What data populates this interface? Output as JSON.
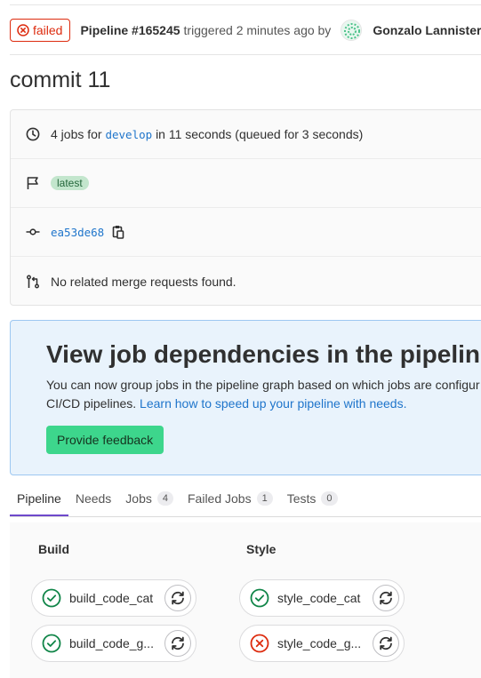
{
  "header": {
    "status_label": "failed",
    "pipeline_id": "Pipeline #165245",
    "triggered_text": "triggered 2 minutes ago by",
    "user_name": "Gonzalo Lannister"
  },
  "commit_title": "commit 11",
  "info": {
    "jobs_prefix": "4 jobs for",
    "branch": "develop",
    "jobs_suffix": "in 11 seconds (queued for 3 seconds)",
    "badge": "latest",
    "commit_sha": "ea53de68",
    "merge_requests": "No related merge requests found."
  },
  "banner": {
    "title": "View job dependencies in the pipeline",
    "text": "You can now group jobs in the pipeline graph based on which jobs are configured to run first, if you use the needs: keyword to establish job dependencies in your CI/CD pipelines.",
    "text_visible_1": "You can now group jobs in the pipeline graph based on which jobs are configur",
    "text_visible_2": "CI/CD pipelines.",
    "link": "Learn how to speed up your pipeline with needs.",
    "button": "Provide feedback"
  },
  "tabs": [
    {
      "label": "Pipeline",
      "count": null
    },
    {
      "label": "Needs",
      "count": null
    },
    {
      "label": "Jobs",
      "count": "4"
    },
    {
      "label": "Failed Jobs",
      "count": "1"
    },
    {
      "label": "Tests",
      "count": "0"
    }
  ],
  "stages": [
    {
      "name": "Build",
      "jobs": [
        {
          "name": "build_code_cat",
          "status": "passed"
        },
        {
          "name": "build_code_g...",
          "status": "passed"
        }
      ]
    },
    {
      "name": "Style",
      "jobs": [
        {
          "name": "style_code_cat",
          "status": "passed"
        },
        {
          "name": "style_code_g...",
          "status": "failed"
        }
      ]
    }
  ],
  "colors": {
    "failed": "#dd2b0e",
    "passed": "#108548",
    "link": "#1f75cb",
    "tab_active": "#6e49cb"
  },
  "icons": [
    "failed-status-icon",
    "clock-icon",
    "flag-icon",
    "commit-icon",
    "copy-icon",
    "merge-request-icon",
    "check-circle-icon",
    "retry-icon"
  ]
}
